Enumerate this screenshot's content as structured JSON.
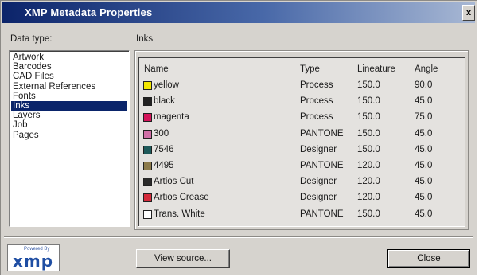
{
  "window": {
    "title": "XMP Metadata Properties",
    "close_glyph": "x"
  },
  "data_type": {
    "label": "Data type:",
    "items": [
      "Artwork",
      "Barcodes",
      "CAD Files",
      "External References",
      "Fonts",
      "Inks",
      "Layers",
      "Job",
      "Pages"
    ],
    "selected": "Inks"
  },
  "section": {
    "label": "Inks"
  },
  "inks_table": {
    "columns": [
      "Name",
      "Type",
      "Lineature",
      "Angle"
    ],
    "rows": [
      {
        "name": "yellow",
        "type": "Process",
        "lineature": "150.0",
        "angle": "90.0",
        "color": "#f2e600"
      },
      {
        "name": "black",
        "type": "Process",
        "lineature": "150.0",
        "angle": "45.0",
        "color": "#222222"
      },
      {
        "name": "magenta",
        "type": "Process",
        "lineature": "150.0",
        "angle": "75.0",
        "color": "#d4145a"
      },
      {
        "name": "300",
        "type": "PANTONE",
        "lineature": "150.0",
        "angle": "45.0",
        "color": "#d06fa6"
      },
      {
        "name": "7546",
        "type": "Designer",
        "lineature": "150.0",
        "angle": "45.0",
        "color": "#1e5a5a"
      },
      {
        "name": "4495",
        "type": "PANTONE",
        "lineature": "120.0",
        "angle": "45.0",
        "color": "#8c7a4a"
      },
      {
        "name": "Artios Cut",
        "type": "Designer",
        "lineature": "120.0",
        "angle": "45.0",
        "color": "#2a2a2a"
      },
      {
        "name": "Artios Crease",
        "type": "Designer",
        "lineature": "120.0",
        "angle": "45.0",
        "color": "#d42a3a"
      },
      {
        "name": "Trans. White",
        "type": "PANTONE",
        "lineature": "150.0",
        "angle": "45.0",
        "color": "#ffffff"
      }
    ]
  },
  "logo": {
    "powered_by": "Powered By",
    "mark": "xmp"
  },
  "buttons": {
    "view_source": "View source...",
    "close": "Close"
  }
}
